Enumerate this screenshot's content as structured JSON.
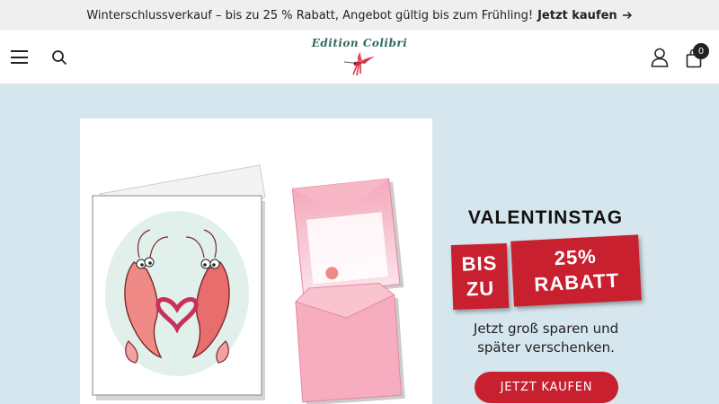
{
  "announcement": {
    "text": "Winterschlussverkauf – bis zu 25 % Rabatt, Angebot gültig bis zum Frühling!",
    "link_label": "Jetzt kaufen",
    "icon": "arrow-right-icon"
  },
  "header": {
    "logo_text": "Edition Colibri",
    "cart_count": "0",
    "icons": [
      "menu-icon",
      "search-icon",
      "hummingbird-logo",
      "user-icon",
      "shopping-bag-icon"
    ]
  },
  "hero": {
    "title": "VALENTINSTAG",
    "tag_left": [
      "BIS",
      "ZU"
    ],
    "tag_right": [
      "25%",
      "RABATT"
    ],
    "text": "Jetzt groß sparen und später verschenken.",
    "cta_label": "JETZT KAUFEN"
  },
  "colors": {
    "accent": "#c8202f",
    "background": "#d6e6ee",
    "logo": "#2c6a60"
  }
}
